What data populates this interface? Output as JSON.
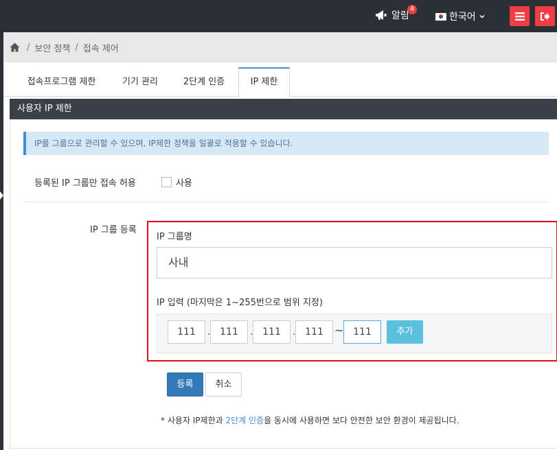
{
  "header": {
    "alarm_label": "알림",
    "alarm_count": "4",
    "language_label": "한국어"
  },
  "breadcrumb": {
    "items": [
      "보안 정책",
      "접속 제어"
    ]
  },
  "tabs": [
    {
      "label": "접속프로그램 제한",
      "active": false
    },
    {
      "label": "기기 관리",
      "active": false
    },
    {
      "label": "2단계 인증",
      "active": false
    },
    {
      "label": "IP 제한",
      "active": true
    }
  ],
  "panel": {
    "title": "사용자 IP 제한",
    "info": "IP를 그룹으로 관리할 수 있으며, IP제한 정책을 일괄로 적용할 수 있습니다.",
    "allow_label": "등록된 IP 그룹만 접속 허용",
    "use_checkbox_label": "사용",
    "use_checked": false,
    "group_register_label": "IP 그룹 등록",
    "group_name_label": "IP 그룹명",
    "group_name_value": "사내",
    "ip_input_label": "IP 입력 (마지막은 1~255번으로 범위 지정)",
    "ip_octets": [
      "111",
      "111",
      "111",
      "111"
    ],
    "ip_range_end": "111",
    "range_separator": "~",
    "add_button": "추가",
    "register_button": "등록",
    "cancel_button": "취소",
    "note_prefix": "* 사용자 IP제한과 ",
    "note_link": "2단계 인증",
    "note_suffix": "을 동시에 사용하면 보다 안전한 보안 환경이 제공됩니다."
  },
  "colors": {
    "topbar": "#2b2f36",
    "accent_red": "#ee3d43",
    "primary_blue": "#337ab7",
    "info_bg": "#d9e8f6",
    "highlight_box": "#e50914"
  }
}
